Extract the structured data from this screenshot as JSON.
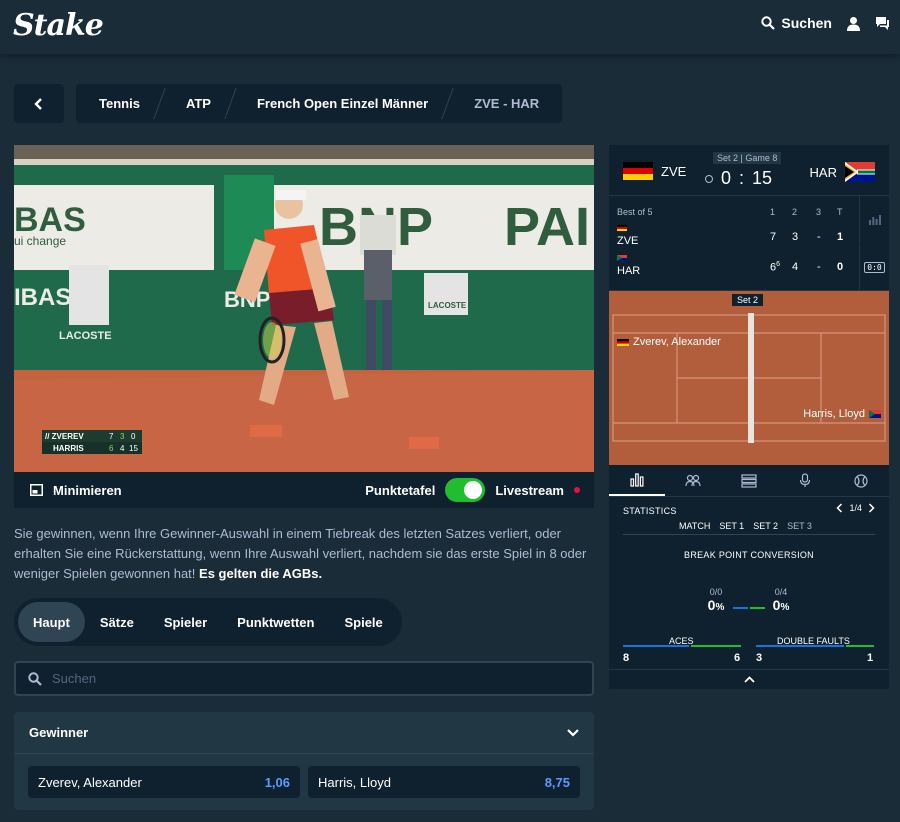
{
  "header": {
    "logo": "Stake",
    "search_label": "Suchen"
  },
  "breadcrumb": {
    "items": [
      "Tennis",
      "ATP",
      "French Open Einzel Männer"
    ],
    "current": "ZVE - HAR"
  },
  "video": {
    "overlay": {
      "p1": "// ZVEREV",
      "p1_s1": "7",
      "p1_s2": "3",
      "p1_pts": "0",
      "p2": "HARRIS",
      "p2_s1": "6",
      "p2_s2": "4",
      "p2_pts": "15"
    },
    "board_texts": [
      "BAS",
      "ui change",
      "BNP",
      "PAI",
      "IBAS",
      "BNP PARI",
      "LACOSTE",
      "LACOSTE"
    ]
  },
  "mini_bar": {
    "minimize_label": "Minimieren",
    "scoreboard_label": "Punktetafel",
    "livestream_label": "Livestream"
  },
  "promo": {
    "text": "Sie gewinnen, wenn Ihre Gewinner-Auswahl in einem Tiebreak des letzten Satzes verliert, oder erhalten Sie eine Rückerstattung, wenn Ihre Auswahl verliert, nachdem sie das erste Spiel in 8 oder weniger Spielen gewonnen hat! ",
    "link": "Es gelten die AGBs."
  },
  "tabs": [
    "Haupt",
    "Sätze",
    "Spieler",
    "Punktwetten",
    "Spiele"
  ],
  "search": {
    "placeholder": "Suchen"
  },
  "market": {
    "title": "Gewinner",
    "outcomes": [
      {
        "name": "Zverev, Alexander",
        "odds": "1,06"
      },
      {
        "name": "Harris, Lloyd",
        "odds": "8,75"
      }
    ]
  },
  "scoreboard": {
    "team1": "ZVE",
    "team2": "HAR",
    "set_game": "Set 2 | Game 8",
    "points1": "0",
    "points_sep": ":",
    "points2": "15",
    "best_of": "Best of 5",
    "columns": [
      "1",
      "2",
      "3",
      "T"
    ],
    "row1": {
      "name": "ZVE",
      "s1": "7",
      "s2": "3",
      "s3": "-",
      "t": "1"
    },
    "row2": {
      "name": "HAR",
      "s1": "6",
      "s1_tb": "6",
      "s2": "4",
      "s3": "-",
      "t": "0"
    },
    "court_label": "Set 2",
    "court_player1": "Zverev, Alexander",
    "court_player2": "Harris, Lloyd",
    "tiebreak_icon": "0:0",
    "colors": {
      "accent_green": "#1fbd30",
      "accent_blue": "#1475e1",
      "panel": "#0f212e"
    }
  },
  "statistics": {
    "title": "STATISTICS",
    "page": "1/4",
    "periods": [
      "MATCH",
      "SET 1",
      "SET 2",
      "SET 3"
    ],
    "bpc_title": "BREAK POINT CONVERSION",
    "bp1_ratio": "0/0",
    "bp1_pct": "0",
    "pct_sign": "%",
    "bp2_ratio": "0/4",
    "bp2_pct": "0",
    "aces_label": "ACES",
    "aces1": "8",
    "aces2": "6",
    "df_label": "DOUBLE FAULTS",
    "df1": "3",
    "df2": "1"
  }
}
